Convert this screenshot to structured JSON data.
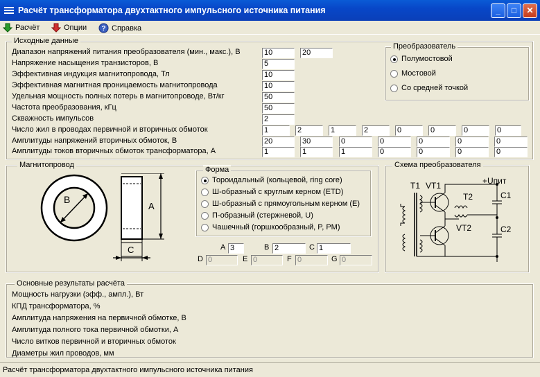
{
  "title": "Расчёт трансформатора двухтактного импульсного источника питания",
  "menu": {
    "calc": "Расчёт",
    "options": "Опции",
    "help": "Справка"
  },
  "input_group": {
    "legend": "Исходные данные",
    "rows": [
      {
        "label": "Диапазон напряжений питания преобразователя (мин., макс.), В",
        "values": [
          "10",
          "20"
        ]
      },
      {
        "label": "Напряжение насыщения транзисторов, В",
        "values": [
          "5"
        ]
      },
      {
        "label": "Эффективная индукция магнитопровода, Тл",
        "values": [
          "10"
        ]
      },
      {
        "label": "Эффективная магнитная проницаемость магнитопровода",
        "values": [
          "10"
        ]
      },
      {
        "label": "Удельная мощность полных потерь в магнитопроводе, Вт/кг",
        "values": [
          "50"
        ]
      },
      {
        "label": "Частота преобразования, кГц",
        "values": [
          "50"
        ]
      },
      {
        "label": "Скважность импульсов",
        "values": [
          "2"
        ]
      },
      {
        "label": "Число жил в проводах первичной и вторичных обмоток",
        "values": [
          "1",
          "2",
          "1",
          "2",
          "0",
          "0",
          "0",
          "0"
        ]
      },
      {
        "label": "Амплитуды напряжений вторичных обмоток, В",
        "values": [
          "20",
          "30",
          "0",
          "0",
          "0",
          "0",
          "0"
        ]
      },
      {
        "label": "Амплитуды токов вторичных обмоток трансформатора, А",
        "values": [
          "1",
          "1",
          "1",
          "0",
          "0",
          "0",
          "0"
        ]
      }
    ]
  },
  "converter": {
    "legend": "Преобразователь",
    "options": [
      "Полумостовой",
      "Мостовой",
      "Со средней точкой"
    ],
    "selected": 0
  },
  "core": {
    "legend": "Магнитопровод",
    "label_b": "B",
    "label_a": "A",
    "label_c": "C"
  },
  "shape": {
    "legend": "Форма",
    "options": [
      "Тороидальный (кольцевой, ring core)",
      "Ш-образный с круглым керном (ETD)",
      "Ш-образный с прямоугольным керном (E)",
      "П-образный (стержневой, U)",
      "Чашечный (горшкообразный, P, PM)"
    ],
    "selected": 0
  },
  "dims": {
    "A": {
      "label": "A",
      "value": "3"
    },
    "B": {
      "label": "B",
      "value": "2"
    },
    "C": {
      "label": "C",
      "value": "1"
    },
    "D": {
      "label": "D",
      "value": "0"
    },
    "E": {
      "label": "E",
      "value": "0"
    },
    "F": {
      "label": "F",
      "value": "0"
    },
    "G": {
      "label": "G",
      "value": "0"
    }
  },
  "scheme": {
    "legend": "Схема преобразователя",
    "t1": "T1",
    "vt1": "VT1",
    "t2": "T2",
    "vt2": "VT2",
    "c1": "C1",
    "c2": "C2",
    "upit": "+Uпит"
  },
  "results": {
    "legend": "Основные результаты расчёта",
    "items": [
      "Мощность нагрузки (эфф., ампл.), Вт",
      "КПД трансформатора, %",
      "Амплитуда напряжения на первичной обмотке, В",
      "Амплитуда полного тока первичной обмотки, А",
      "Число витков первичной и вторичных обмоток",
      "Диаметры жил проводов, мм"
    ]
  },
  "status": "Расчёт трансформатора двухтактного импульсного источника питания",
  "colors": {
    "titlebar": "#0a5bd6",
    "face": "#ece9d8"
  }
}
